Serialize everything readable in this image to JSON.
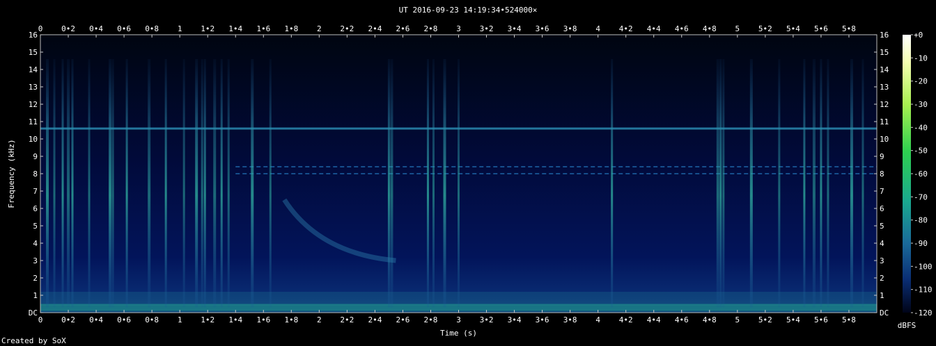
{
  "chart_data": {
    "type": "heatmap",
    "title": "UT 2016-09-23 14:19:34•524000×",
    "xlabel": "Time (s)",
    "ylabel": "Frequency (kHz)",
    "x_ticks": [
      "0",
      "0•2",
      "0•4",
      "0•6",
      "0•8",
      "1",
      "1•2",
      "1•4",
      "1•6",
      "1•8",
      "2",
      "2•2",
      "2•4",
      "2•6",
      "2•8",
      "3",
      "3•2",
      "3•4",
      "3•6",
      "3•8",
      "4",
      "4•2",
      "4•4",
      "4•6",
      "4•8",
      "5",
      "5•2",
      "5•4",
      "5•6",
      "5•8"
    ],
    "y_ticks": [
      "DC",
      "1",
      "2",
      "3",
      "4",
      "5",
      "6",
      "7",
      "8",
      "9",
      "10",
      "11",
      "12",
      "13",
      "14",
      "15",
      "16"
    ],
    "xlim": [
      0,
      6
    ],
    "ylim": [
      0,
      16
    ],
    "colorbar": {
      "label": "dBFS",
      "ticks": [
        "+0",
        "-10",
        "-20",
        "-30",
        "-40",
        "-50",
        "-60",
        "-70",
        "-80",
        "-90",
        "-100",
        "-110",
        "-120"
      ],
      "range": [
        -120,
        0
      ]
    },
    "features": {
      "horizontal_tones_khz": [
        10.6,
        8.4,
        8.0
      ],
      "broadband_bursts_s": [
        0.05,
        0.1,
        0.16,
        0.2,
        0.23,
        0.35,
        0.5,
        0.52,
        0.62,
        0.78,
        0.9,
        1.03,
        1.12,
        1.16,
        1.18,
        1.25,
        1.3,
        1.35,
        1.52,
        1.65,
        2.5,
        2.52,
        2.78,
        2.82,
        2.9,
        3.0,
        4.1,
        4.86,
        4.88,
        4.9,
        5.1,
        5.3,
        5.48,
        5.55,
        5.6,
        5.65,
        5.82,
        5.9
      ],
      "descending_chirp": {
        "start_s": 1.75,
        "start_khz": 6.5,
        "end_s": 2.55,
        "end_khz": 3.0
      }
    }
  },
  "credit": "Created by SoX"
}
